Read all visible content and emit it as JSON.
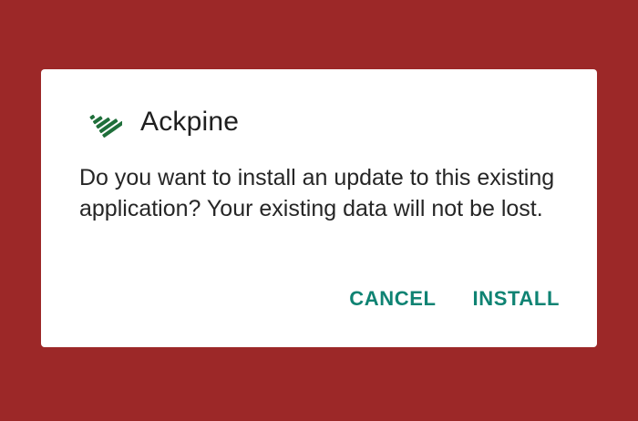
{
  "colors": {
    "backdrop": "#9c2828",
    "accent": "#0f8373",
    "icon": "#1f6f3a"
  },
  "dialog": {
    "icon": "ackpine-leaf-icon",
    "title": "Ackpine",
    "message": "Do you want to install an update to this existing application? Your existing data will not be lost.",
    "buttons": {
      "cancel": "CANCEL",
      "install": "INSTALL"
    }
  }
}
